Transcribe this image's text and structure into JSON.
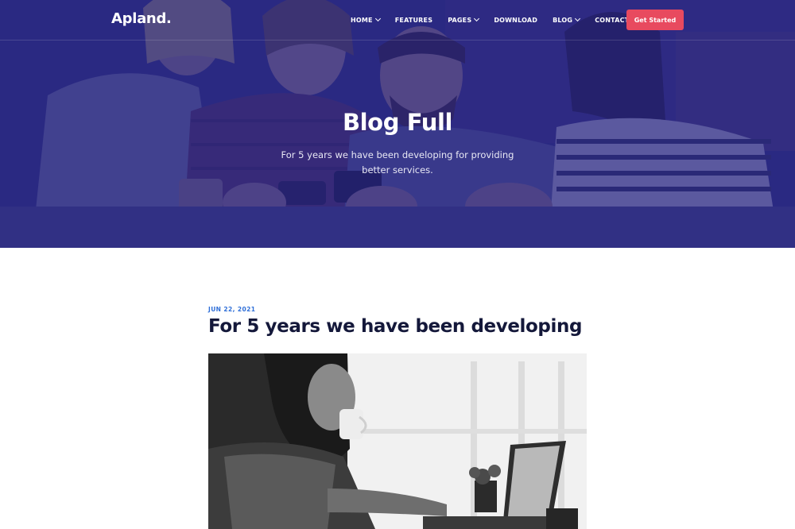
{
  "header": {
    "logo": "Apland.",
    "nav": [
      {
        "label": "HOME",
        "has_dropdown": true
      },
      {
        "label": "FEATURES",
        "has_dropdown": false
      },
      {
        "label": "PAGES",
        "has_dropdown": true
      },
      {
        "label": "DOWNLOAD",
        "has_dropdown": false
      },
      {
        "label": "BLOG",
        "has_dropdown": true
      },
      {
        "label": "CONTACT",
        "has_dropdown": false
      }
    ],
    "cta_label": "Get Started"
  },
  "hero": {
    "title": "Blog Full",
    "subtitle": "For 5 years we have been developing for providing better services."
  },
  "post": {
    "date": "JUN 22, 2021",
    "title": "For 5 years we have been developing"
  },
  "colors": {
    "hero_overlay": "#2c2b7a",
    "cta": "#e84a5f",
    "date_accent": "#2f6fd8",
    "heading": "#14183a"
  }
}
